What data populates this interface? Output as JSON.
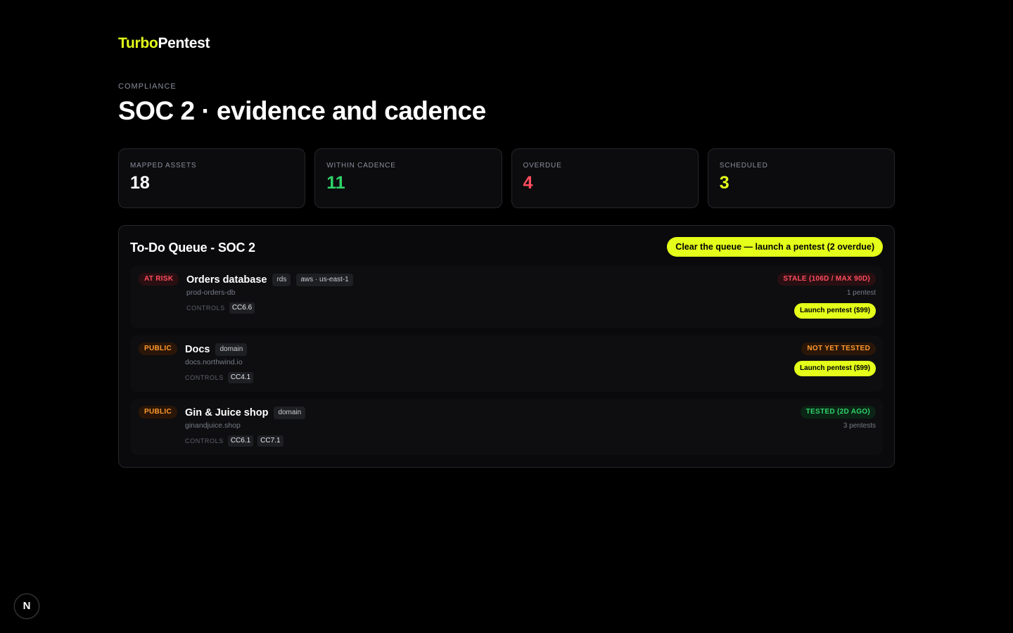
{
  "brand": {
    "part1": "Turbo",
    "part2": "Pentest"
  },
  "header": {
    "eyebrow": "COMPLIANCE",
    "title": "SOC 2 · evidence and cadence"
  },
  "stats": [
    {
      "label": "MAPPED ASSETS",
      "value": "18",
      "color": "#ffffff"
    },
    {
      "label": "WITHIN CADENCE",
      "value": "11",
      "color": "#2fd46b"
    },
    {
      "label": "OVERDUE",
      "value": "4",
      "color": "#ff4d5e"
    },
    {
      "label": "SCHEDULED",
      "value": "3",
      "color": "#e4ff1a"
    }
  ],
  "queue": {
    "title": "To-Do Queue - SOC 2",
    "cta": "Clear the queue — launch a pentest (2 overdue)",
    "controls_label": "CONTROLS",
    "rows": [
      {
        "badge": "AT RISK",
        "name": "Orders database",
        "tags": [
          "rds",
          "aws · us-east-1"
        ],
        "host": "prod-orders-db",
        "controls": [
          "CC6.6"
        ],
        "status": "STALE (106D / MAX 90D)",
        "count": "1 pentest",
        "action": "Launch pentest ($99)"
      },
      {
        "badge": "PUBLIC",
        "name": "Docs",
        "tags": [
          "domain"
        ],
        "host": "docs.northwind.io",
        "controls": [
          "CC4.1"
        ],
        "status": "NOT YET TESTED",
        "count": "",
        "action": "Launch pentest ($99)"
      },
      {
        "badge": "PUBLIC",
        "name": "Gin & Juice shop",
        "tags": [
          "domain"
        ],
        "host": "ginandjuice.shop",
        "controls": [
          "CC6.1",
          "CC7.1"
        ],
        "status": "TESTED (2D AGO)",
        "count": "3 pentests",
        "action": ""
      }
    ]
  },
  "dev_indicator": {
    "glyph": "N",
    "icon": "nextjs-icon"
  },
  "colors": {
    "accent": "#e4ff1a",
    "danger": "#ff4d5e",
    "warning": "#ff9a2e",
    "success": "#2fd46b"
  }
}
